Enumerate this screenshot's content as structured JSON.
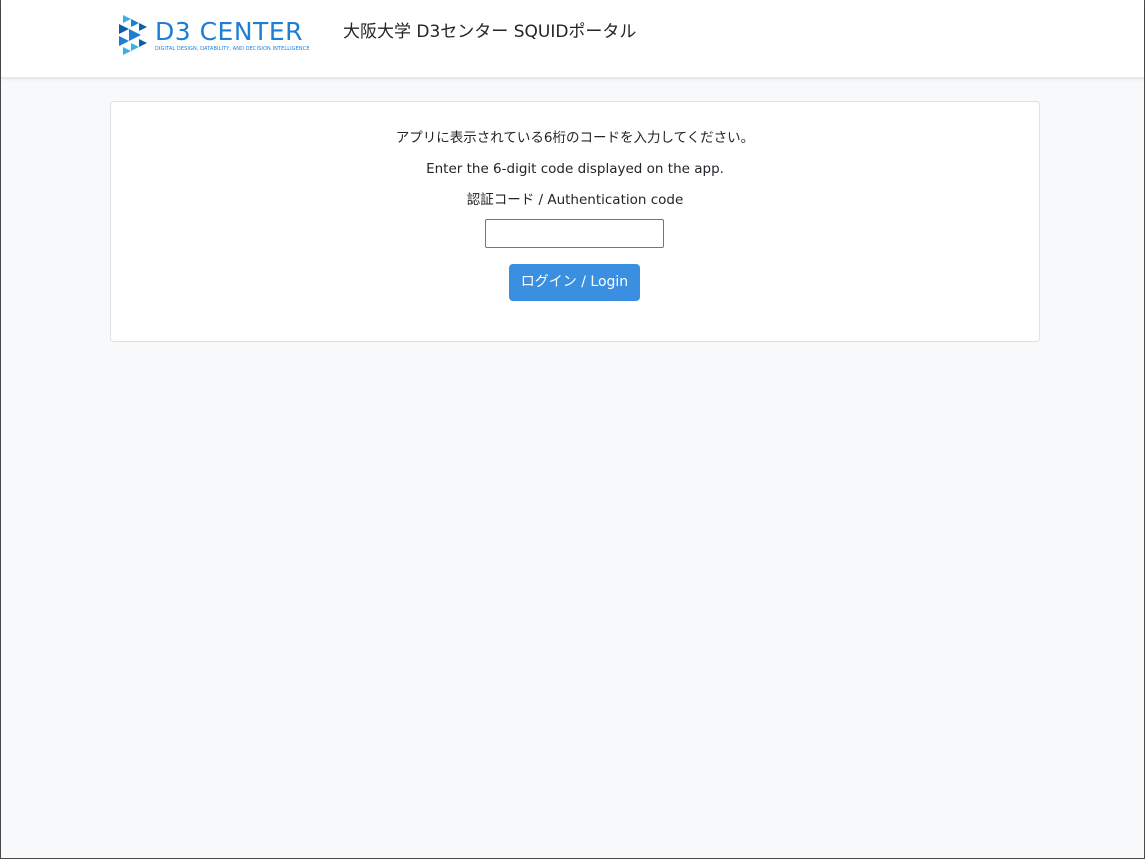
{
  "header": {
    "logo": {
      "wordmark": "D3 CENTER",
      "tagline": "DIGITAL DESIGN, DATABILITY, AND DECISION INTELLIGENCE",
      "icon": "d3-center-logo-icon",
      "color": "#1c7ed6"
    },
    "title": "大阪大学 D3センター SQUIDポータル"
  },
  "auth": {
    "instruction_ja": "アプリに表示されている6桁のコードを入力してください。",
    "instruction_en": "Enter the 6-digit code displayed on the app.",
    "code_label": "認証コード / Authentication code",
    "code_value": "",
    "login_label": "ログイン / Login",
    "button_color": "#3a8fe0"
  }
}
